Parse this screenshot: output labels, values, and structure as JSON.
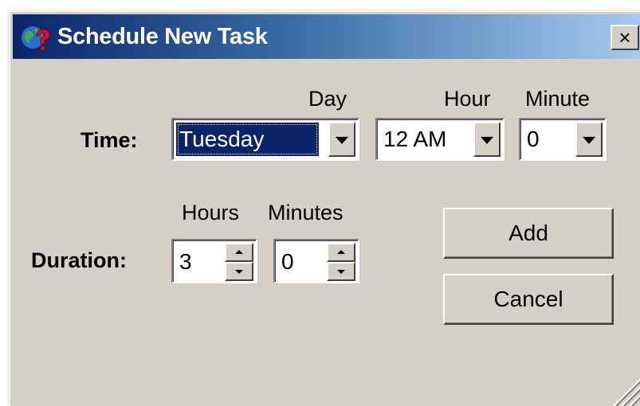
{
  "window": {
    "title": "Schedule New Task",
    "close_label": "×"
  },
  "time": {
    "label": "Time:",
    "day": {
      "header": "Day",
      "value": "Tuesday"
    },
    "hour": {
      "header": "Hour",
      "value": "12 AM"
    },
    "minute": {
      "header": "Minute",
      "value": "0"
    }
  },
  "duration": {
    "label": "Duration:",
    "hours": {
      "header": "Hours",
      "value": "3"
    },
    "minutes": {
      "header": "Minutes",
      "value": "0"
    }
  },
  "buttons": {
    "add": "Add",
    "cancel": "Cancel"
  },
  "colors": {
    "titlebar_start": "#0a246a",
    "titlebar_end": "#a6caf0",
    "dialog_bg": "#d4d0c8",
    "selection": "#0a246a"
  },
  "icons": {
    "app": "globe-question-icon",
    "close": "close-icon",
    "dropdown": "chevron-down-icon",
    "resize": "resize-grip-icon"
  }
}
